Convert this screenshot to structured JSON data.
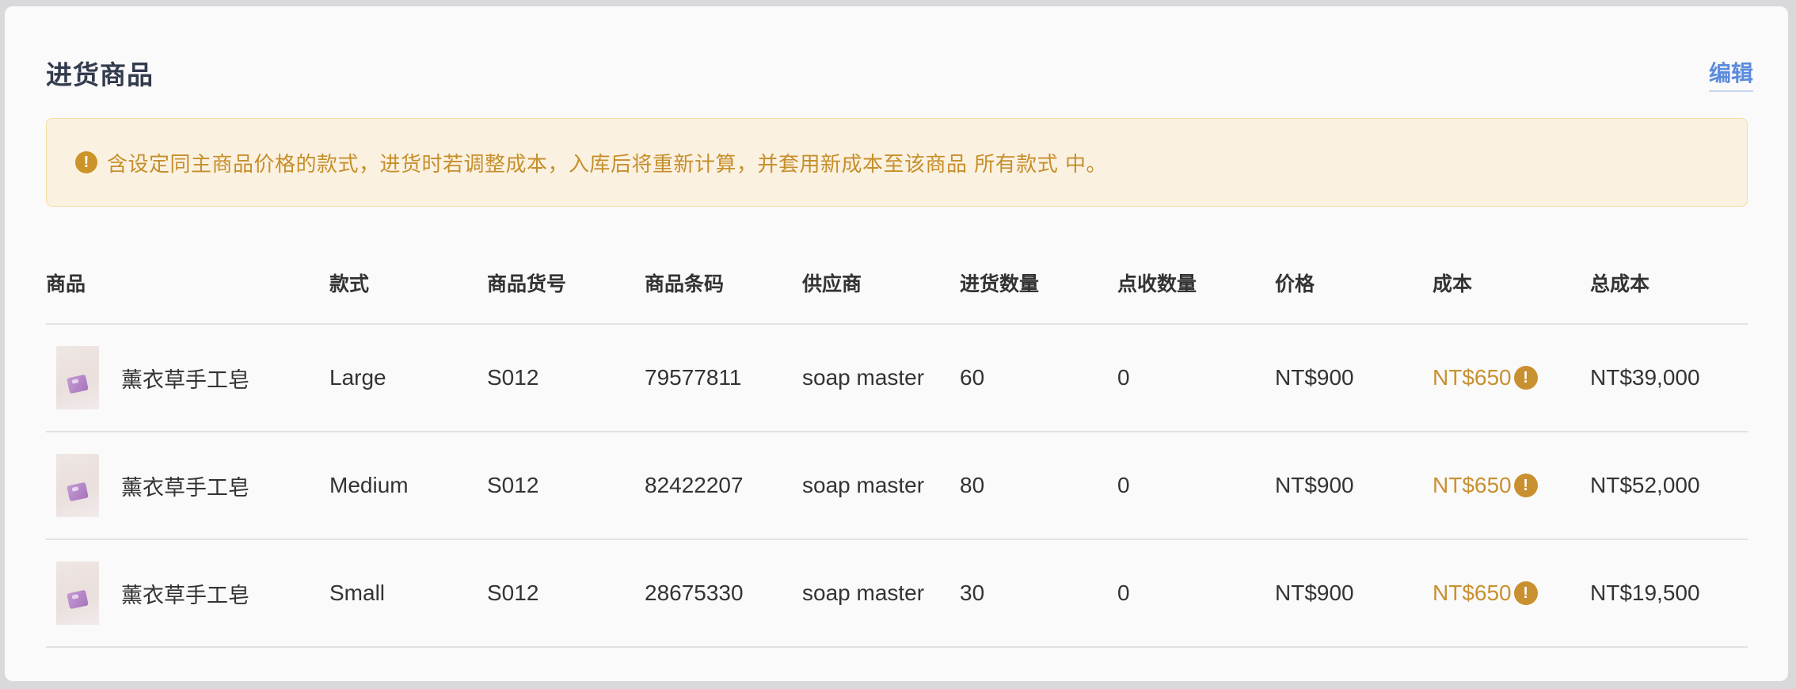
{
  "header": {
    "title": "进货商品",
    "edit_label": "编辑"
  },
  "notice": {
    "icon": "exclamation-circle-icon",
    "text": "含设定同主商品价格的款式，进货时若调整成本，入库后将重新计算，并套用新成本至该商品 所有款式 中。"
  },
  "colors": {
    "accent_link": "#5b8bdc",
    "warning": "#c99030",
    "notice_bg": "#fbf1e1"
  },
  "table": {
    "columns": [
      "商品",
      "款式",
      "商品货号",
      "商品条码",
      "供应商",
      "进货数量",
      "点收数量",
      "价格",
      "成本",
      "总成本"
    ],
    "rows": [
      {
        "product": "薰衣草手工皂",
        "variant": "Large",
        "sku": "S012",
        "barcode": "79577811",
        "supplier": "soap master",
        "qty": "60",
        "received": "0",
        "price": "NT$900",
        "cost": "NT$650",
        "total": "NT$39,000"
      },
      {
        "product": "薰衣草手工皂",
        "variant": "Medium",
        "sku": "S012",
        "barcode": "82422207",
        "supplier": "soap master",
        "qty": "80",
        "received": "0",
        "price": "NT$900",
        "cost": "NT$650",
        "total": "NT$52,000"
      },
      {
        "product": "薰衣草手工皂",
        "variant": "Small",
        "sku": "S012",
        "barcode": "28675330",
        "supplier": "soap master",
        "qty": "30",
        "received": "0",
        "price": "NT$900",
        "cost": "NT$650",
        "total": "NT$19,500"
      }
    ]
  }
}
